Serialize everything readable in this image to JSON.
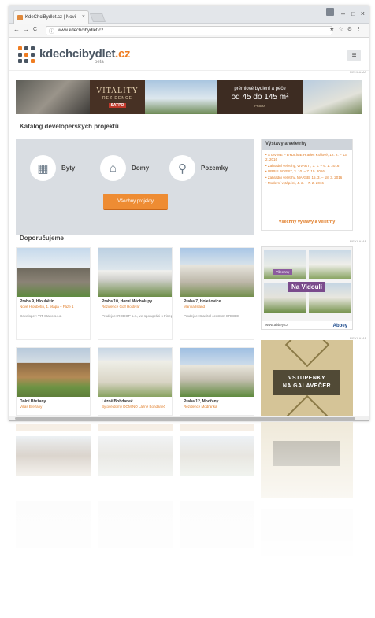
{
  "browser": {
    "tab_title": "KdeChciBydlet.cz | Novi",
    "tab_close": "×",
    "url": "www.kdechcibydlet.cz",
    "info_icon": "ⓘ",
    "win_min": "–",
    "win_max": "□",
    "win_close": "×",
    "nav_back": "←",
    "nav_fwd": "→",
    "nav_reload": "C",
    "right_icons": "★☆⚙⋮"
  },
  "site": {
    "logo_text": "kdechcibydlet",
    "logo_tld": ".cz",
    "beta": "beta",
    "menu_icon": "≡"
  },
  "banner": {
    "reklama": "REKLAMA",
    "vitality": "VITALITY",
    "rezidence": "REZIDENCE",
    "satpo": "SATPO",
    "tagline": "prémiové bydlení a péče",
    "size": "od 45 do 145 m²",
    "place": "PRAHA"
  },
  "catalog": {
    "title": "Katalog developerských projektů",
    "byty": "Byty",
    "domy": "Domy",
    "pozemky": "Pozemky",
    "all_button": "Všechny projekty"
  },
  "events": {
    "title": "Výstavy a veletrhy",
    "items": [
      "• STAVÍME – BYDLÍME Hradec Králové, 12. 2. – 13. 2. 2016",
      "• Zahradní veletrhy, VIVARTI, 3. 1. – 6. 1. 2016",
      "• URBIS INVEST, 3. 10. – 7. 10. 2016",
      "• Zahradní veletrhy, MARSB, 15. 3. – 18. 3. 2016",
      "• Moderní vytápění, 4. 2. – 7. 2. 2016"
    ],
    "all": "Všechny výstavy a veletrhy"
  },
  "recommended": {
    "title": "Doporučujeme",
    "reklama": "REKLAMA",
    "cards": [
      {
        "title": "Praha 9, Hloubětín",
        "sub": "Nové Hloubětín, 1. etapa – Fáze 1",
        "dev": "Developer: YIT Stavo s.r.o."
      },
      {
        "title": "Praha 10, Horní Měcholupy",
        "sub": "Rezidence Golf Hostivař",
        "dev": "Prodejce: RODOP a.s., ve spolupráci s Finep"
      },
      {
        "title": "Praha 7, Holešovice",
        "sub": "Marina Island",
        "dev": "Prodejce: Stavitel centrum CREDIS"
      },
      {
        "title": "Dolní Břežany",
        "sub": "Villas Břežany",
        "dev": ""
      },
      {
        "title": "Lázně Bohdaneč",
        "sub": "Bytové domy DOMINO Lázně Bohdaneč",
        "dev": ""
      },
      {
        "title": "Praha 12, Modřany",
        "sub": "Rezidence Modřanka",
        "dev": ""
      }
    ]
  },
  "ad_vidouli": {
    "tag": "Všechny",
    "name": "Na Vidouli",
    "footer": "www.abbey.cz",
    "brand": "Abbey"
  },
  "ad_galavecer": {
    "line1": "VSTUPENKY",
    "line2": "NA GALAVEČER",
    "reklama": "REKLAMA"
  },
  "colors": {
    "accent": "#ee8c33",
    "logo_dark": "#4a5663",
    "panel": "#d9dde2"
  },
  "icons": {
    "byty": "apartment-icon",
    "domy": "house-icon",
    "pozemky": "land-plot-icon"
  }
}
